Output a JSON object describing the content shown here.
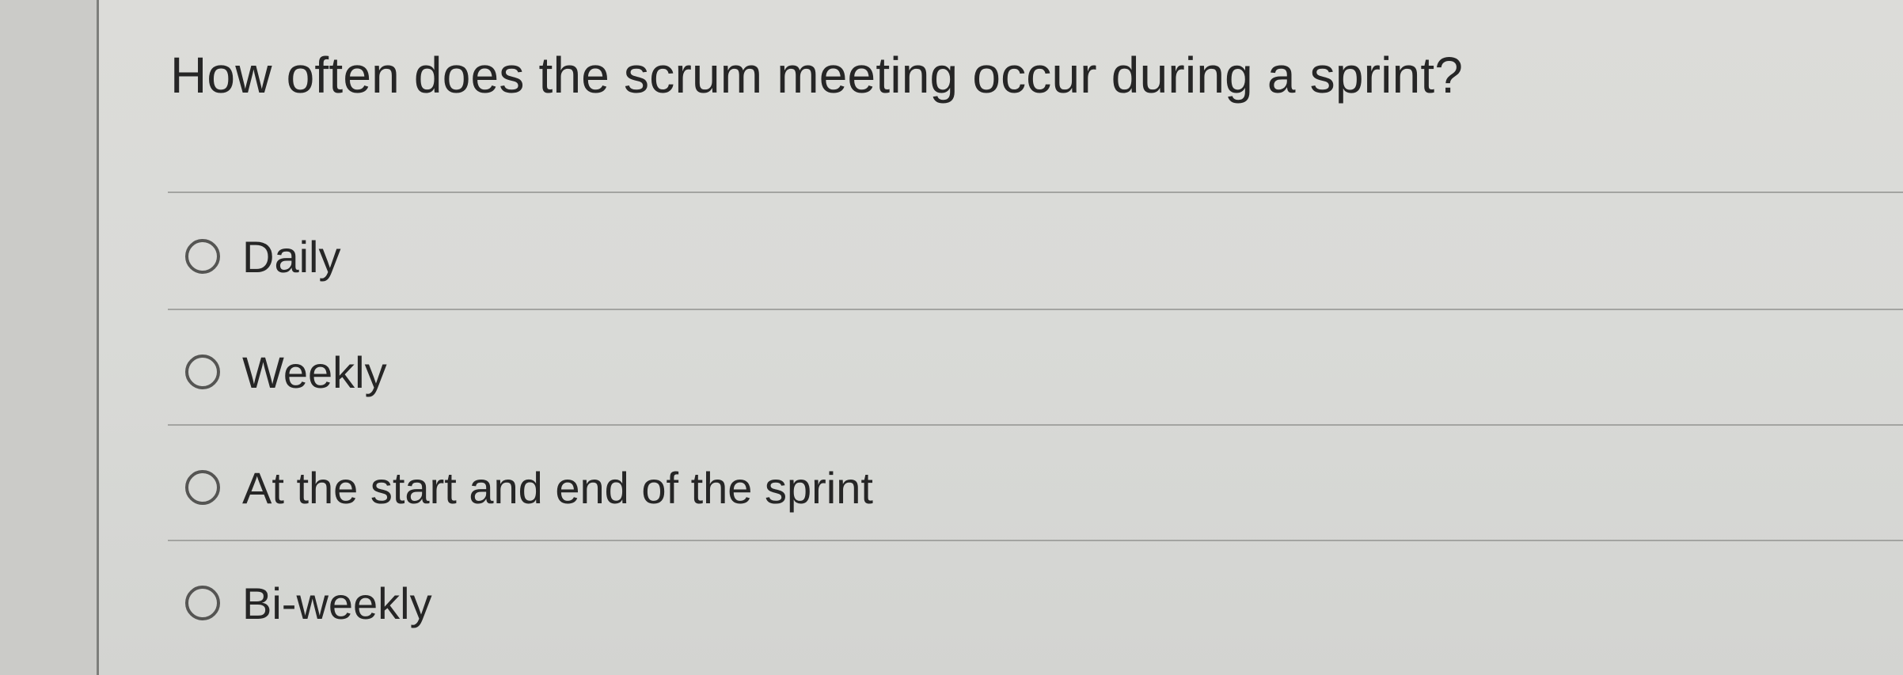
{
  "question": {
    "text": "How often does the scrum meeting occur during a sprint?"
  },
  "options": [
    {
      "label": "Daily",
      "selected": false
    },
    {
      "label": "Weekly",
      "selected": false
    },
    {
      "label": "At the start and end of the sprint",
      "selected": false
    },
    {
      "label": "Bi-weekly",
      "selected": false
    }
  ]
}
